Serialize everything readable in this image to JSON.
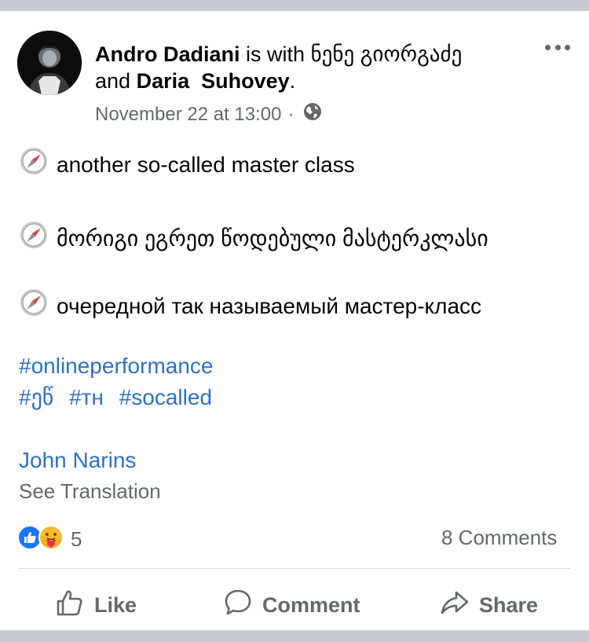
{
  "post": {
    "author": "Andro Dadiani",
    "with_text": "is with",
    "tagged_1": "ნენე გიორგაძე",
    "and_text": "and",
    "tagged_2": "Daria  Suhovey",
    "period": ".",
    "timestamp": "November 22 at 13:00",
    "separator": "·",
    "lines": [
      "another so-called master class",
      "მორიგი ეგრეთ წოდებული მასტერკლასი",
      "очередной так называемый мастер-класс"
    ],
    "hashtags_row1": [
      "#onlineperformance"
    ],
    "hashtags_row2": [
      "#ეწ",
      "#тн",
      "#socalled"
    ],
    "mention": "John Narins",
    "see_translation": "See Translation"
  },
  "stats": {
    "reaction_count": "5",
    "comments": "8 Comments"
  },
  "actions": {
    "like": "Like",
    "comment": "Comment",
    "share": "Share"
  },
  "colors": {
    "link": "#2d70c7",
    "secondary_text": "#65676b",
    "like_blue": "#1877f2",
    "care_yellow": "#f7b928"
  },
  "icons": [
    "avatar",
    "more-dots-icon",
    "globe-icon",
    "compass-icon",
    "like-reaction-icon",
    "care-reaction-icon",
    "thumbs-up-icon",
    "comment-bubble-icon",
    "share-arrow-icon"
  ]
}
